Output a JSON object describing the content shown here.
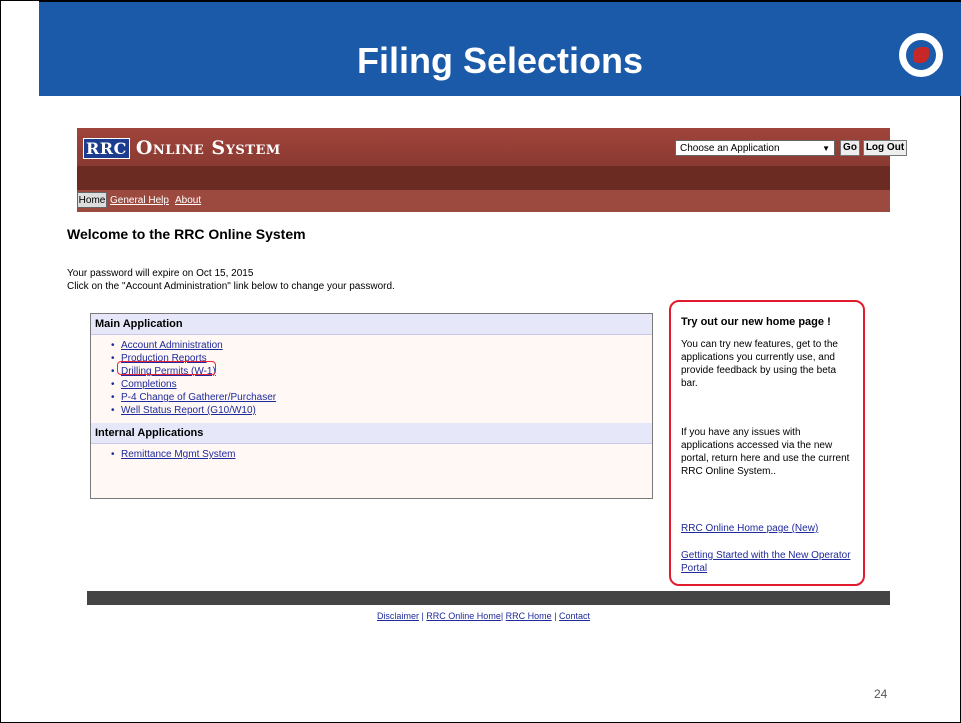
{
  "slide": {
    "title": "Filing Selections",
    "page_number": "24",
    "seal_label": "Railroad Commission of Texas seal"
  },
  "app": {
    "logo_badge": "RRC",
    "logo_title": "Online System",
    "application_select": {
      "value": "Choose an Application"
    },
    "go_label": "Go",
    "logout_label": "Log Out"
  },
  "nav": {
    "home": "Home",
    "general_help": "General Help",
    "about": "About"
  },
  "welcome": "Welcome to the RRC Online System",
  "password_notice": [
    "Your password will expire on Oct 15, 2015",
    "Click on the \"Account Administration\" link below to change your password."
  ],
  "main_application": {
    "heading": "Main Application",
    "links": [
      "Account Administration",
      "Production Reports",
      "Drilling Permits (W-1)",
      "Completions",
      "P-4 Change of Gatherer/Purchaser",
      "Well Status Report (G10/W10)"
    ]
  },
  "internal_applications": {
    "heading": "Internal Applications",
    "links": [
      "Remittance Mgmt System"
    ]
  },
  "sidebar": {
    "title": "Try out our new home page !",
    "p1": "You can try new features, get to the applications you currently use, and provide feedback by using the beta bar.",
    "p2": "If you have any issues with applications accessed via the new portal, return here and use the current RRC Online System..",
    "link1": "RRC Online Home page (New)",
    "link2": "Getting Started with the New Operator Portal"
  },
  "footer": {
    "disclaimer": "Disclaimer",
    "sep1": " | ",
    "rrc_online_home": "RRC Online Home",
    "sep2": "| ",
    "rrc_home": "RRC Home",
    "sep3": " | ",
    "contact": "Contact"
  },
  "colors": {
    "title_bar": "#1a5aa8",
    "header": "#8a3a32",
    "highlight": "#e21a2e",
    "link": "#1f2a9c"
  }
}
